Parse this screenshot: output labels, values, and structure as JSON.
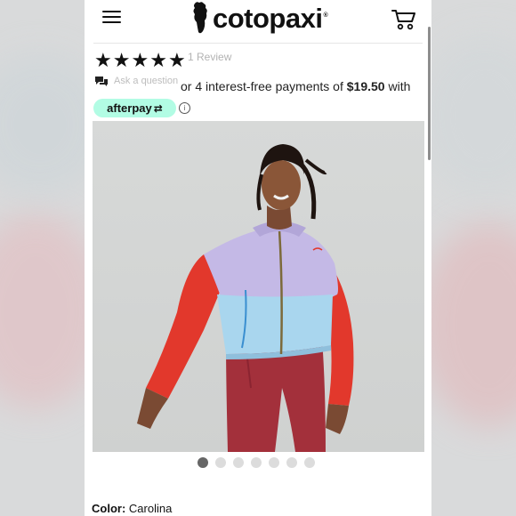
{
  "header": {
    "logo_text": "cotopaxi",
    "logo_mark": "®",
    "menu_icon": "hamburger-menu-icon",
    "cart_icon": "shopping-cart-icon"
  },
  "rating": {
    "stars": 5,
    "star_glyph": "★",
    "review_count": "1 Review"
  },
  "ask": {
    "label": "Ask a question",
    "icon": "chat-bubbles-icon"
  },
  "payment": {
    "prefix": "or 4 interest-free payments of ",
    "amount": "$19.50",
    "suffix": " with",
    "provider": "afterpay",
    "provider_arrows": "⇄",
    "info_glyph": "i"
  },
  "product_image": {
    "description_icon": "product-photo-woman-windbreaker"
  },
  "carousel": {
    "total": 7,
    "active_index": 0
  },
  "product": {
    "color_label": "Color:",
    "color_value": " Carolina"
  },
  "colors": {
    "afterpay_mint": "#b2fce4",
    "jacket_lavender": "#c4b9e6",
    "jacket_sky": "#a9d6ee",
    "jacket_red": "#e2382c",
    "leggings_maroon": "#a3303b"
  }
}
